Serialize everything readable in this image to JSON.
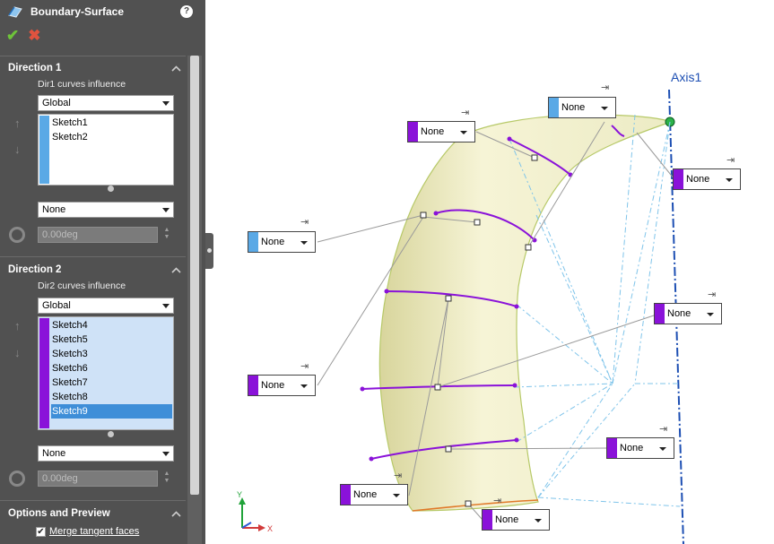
{
  "panel": {
    "title": "Boundary-Surface",
    "help": "?",
    "ok": "✔",
    "cancel": "✖",
    "direction1": {
      "title": "Direction 1",
      "influence_label": "Dir1 curves influence",
      "influence_value": "Global",
      "curves": [
        "Sketch1",
        "Sketch2"
      ],
      "strip_color": "#5aa9e6",
      "tangency_value": "None",
      "angle_value": "0.00deg"
    },
    "direction2": {
      "title": "Direction 2",
      "influence_label": "Dir2 curves influence",
      "influence_value": "Global",
      "curves": [
        "Sketch4",
        "Sketch5",
        "Sketch3",
        "Sketch6",
        "Sketch7",
        "Sketch8",
        "Sketch9"
      ],
      "selected_curve": "Sketch9",
      "strip_color": "#8a12d9",
      "tangency_value": "None",
      "angle_value": "0.00deg"
    },
    "options": {
      "title": "Options and Preview",
      "merge_label": "Merge tangent faces",
      "merge_checked": "✔"
    }
  },
  "viewport": {
    "axis_label": "Axis1",
    "tags": [
      {
        "value": "None",
        "color": "#5aa9e6"
      },
      {
        "value": "None",
        "color": "#8a12d9"
      },
      {
        "value": "None",
        "color": "#8a12d9"
      },
      {
        "value": "None",
        "color": "#5aa9e6"
      },
      {
        "value": "None",
        "color": "#8a12d9"
      },
      {
        "value": "None",
        "color": "#8a12d9"
      },
      {
        "value": "None",
        "color": "#8a12d9"
      },
      {
        "value": "None",
        "color": "#8a12d9"
      },
      {
        "value": "None",
        "color": "#8a12d9"
      }
    ],
    "triad": {
      "y": "Y",
      "x": "X"
    }
  },
  "colors": {
    "panel_bg": "#515151",
    "surface": "#f3f1c9",
    "dir1": "#5aa9e6",
    "dir2": "#8a12d9",
    "axis": "#1d4fb3"
  }
}
